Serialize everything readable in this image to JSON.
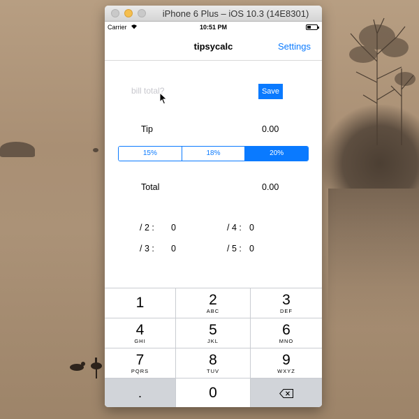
{
  "window": {
    "title": "iPhone 6 Plus – iOS 10.3 (14E8301)"
  },
  "status_bar": {
    "carrier": "Carrier",
    "time": "10:51 PM"
  },
  "nav": {
    "title": "tipsycalc",
    "settings_label": "Settings"
  },
  "bill": {
    "placeholder": "bill total?",
    "save_label": "Save"
  },
  "tip": {
    "label": "Tip",
    "value": "0.00"
  },
  "tip_options": [
    "15%",
    "18%",
    "20%"
  ],
  "selected_tip": "20%",
  "total": {
    "label": "Total",
    "value": "0.00"
  },
  "splits": [
    {
      "label": "/ 2 :",
      "value": "0"
    },
    {
      "label": "/ 3 :",
      "value": "0"
    },
    {
      "label": "/ 4 :",
      "value": "0"
    },
    {
      "label": "/ 5 :",
      "value": "0"
    }
  ],
  "keypad": {
    "keys": [
      {
        "num": "1",
        "letters": ""
      },
      {
        "num": "2",
        "letters": "ABC"
      },
      {
        "num": "3",
        "letters": "DEF"
      },
      {
        "num": "4",
        "letters": "GHI"
      },
      {
        "num": "5",
        "letters": "JKL"
      },
      {
        "num": "6",
        "letters": "MNO"
      },
      {
        "num": "7",
        "letters": "PQRS"
      },
      {
        "num": "8",
        "letters": "TUV"
      },
      {
        "num": "9",
        "letters": "WXYZ"
      }
    ],
    "dot": ".",
    "zero": "0",
    "delete_icon": "backspace-icon"
  },
  "colors": {
    "accent": "#0a7aff",
    "keypad_dark": "#d1d4d9"
  }
}
